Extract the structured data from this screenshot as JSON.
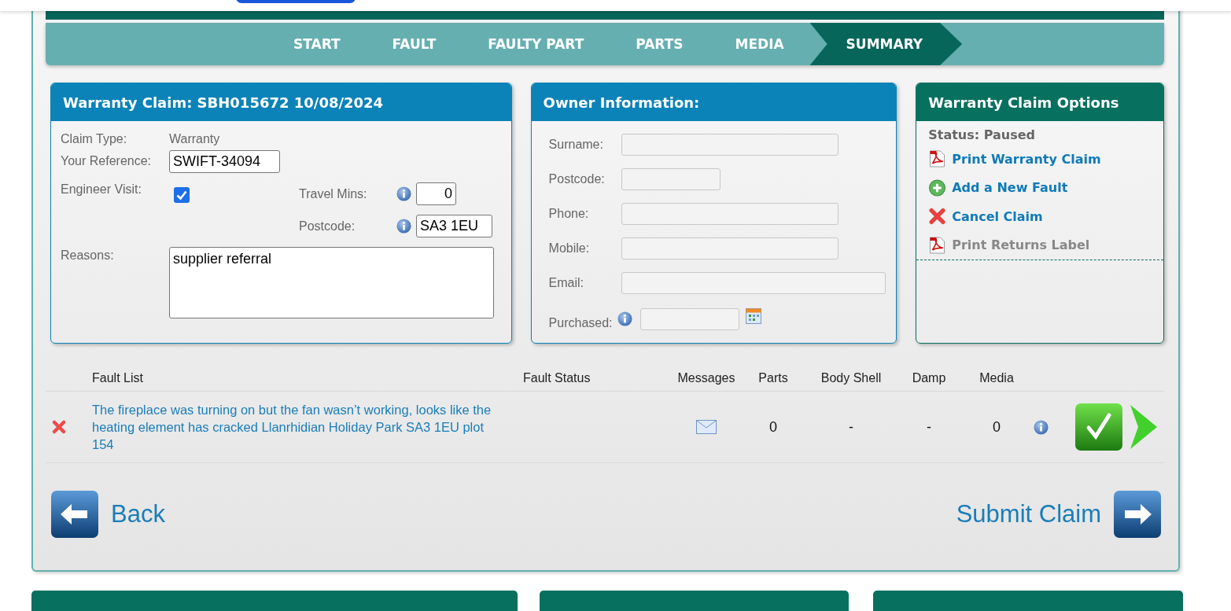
{
  "steps": [
    {
      "label": "START",
      "selected": false
    },
    {
      "label": "FAULT",
      "selected": false
    },
    {
      "label": "FAULTY PART",
      "selected": false
    },
    {
      "label": "PARTS",
      "selected": false
    },
    {
      "label": "MEDIA",
      "selected": false
    },
    {
      "label": "SUMMARY",
      "selected": true
    }
  ],
  "claim": {
    "title": "Warranty Claim: SBH015672 10/08/2024",
    "claim_type_label": "Claim Type:",
    "claim_type": "Warranty",
    "reference_label": "Your Reference:",
    "reference": "SWIFT-34094",
    "engineer_visit_label": "Engineer Visit:",
    "engineer_visit_checked": true,
    "travel_label": "Travel Mins:",
    "travel_mins": "0",
    "postcode_label": "Postcode:",
    "postcode": "SA3 1EU",
    "reasons_label": "Reasons:",
    "reasons": "supplier referral"
  },
  "owner": {
    "title": "Owner Information:",
    "fields": [
      {
        "label": "Surname:",
        "kind": "medium"
      },
      {
        "label": "Postcode:",
        "kind": "short"
      },
      {
        "label": "Phone:",
        "kind": "medium"
      },
      {
        "label": "Mobile:",
        "kind": "medium"
      },
      {
        "label": "Email:",
        "kind": "long"
      },
      {
        "label": "Purchased:",
        "kind": "date"
      }
    ]
  },
  "options": {
    "title": "Warranty Claim Options",
    "status": "Status: Paused",
    "actions": [
      {
        "label": "Print Warranty Claim",
        "kind": "pdf",
        "disabled": false
      },
      {
        "label": "Add a New Fault",
        "kind": "add",
        "disabled": false
      },
      {
        "label": "Cancel Claim",
        "kind": "cancel",
        "disabled": false
      },
      {
        "label": "Print Returns Label",
        "kind": "pdf",
        "disabled": true
      }
    ]
  },
  "faults": {
    "columns": [
      "Fault List",
      "Fault Status",
      "Messages",
      "Parts",
      "Body Shell",
      "Damp",
      "Media"
    ],
    "rows": [
      {
        "description": "The fireplace was turning on but the fan wasn’t working, looks like the heating element has cracked Llanrhidian Holiday Park SA3 1EU plot 154",
        "parts": "0",
        "body_shell": "-",
        "damp": "-",
        "media": "0",
        "complete": true
      }
    ]
  },
  "back": "Back",
  "submit": "Submit Claim"
}
